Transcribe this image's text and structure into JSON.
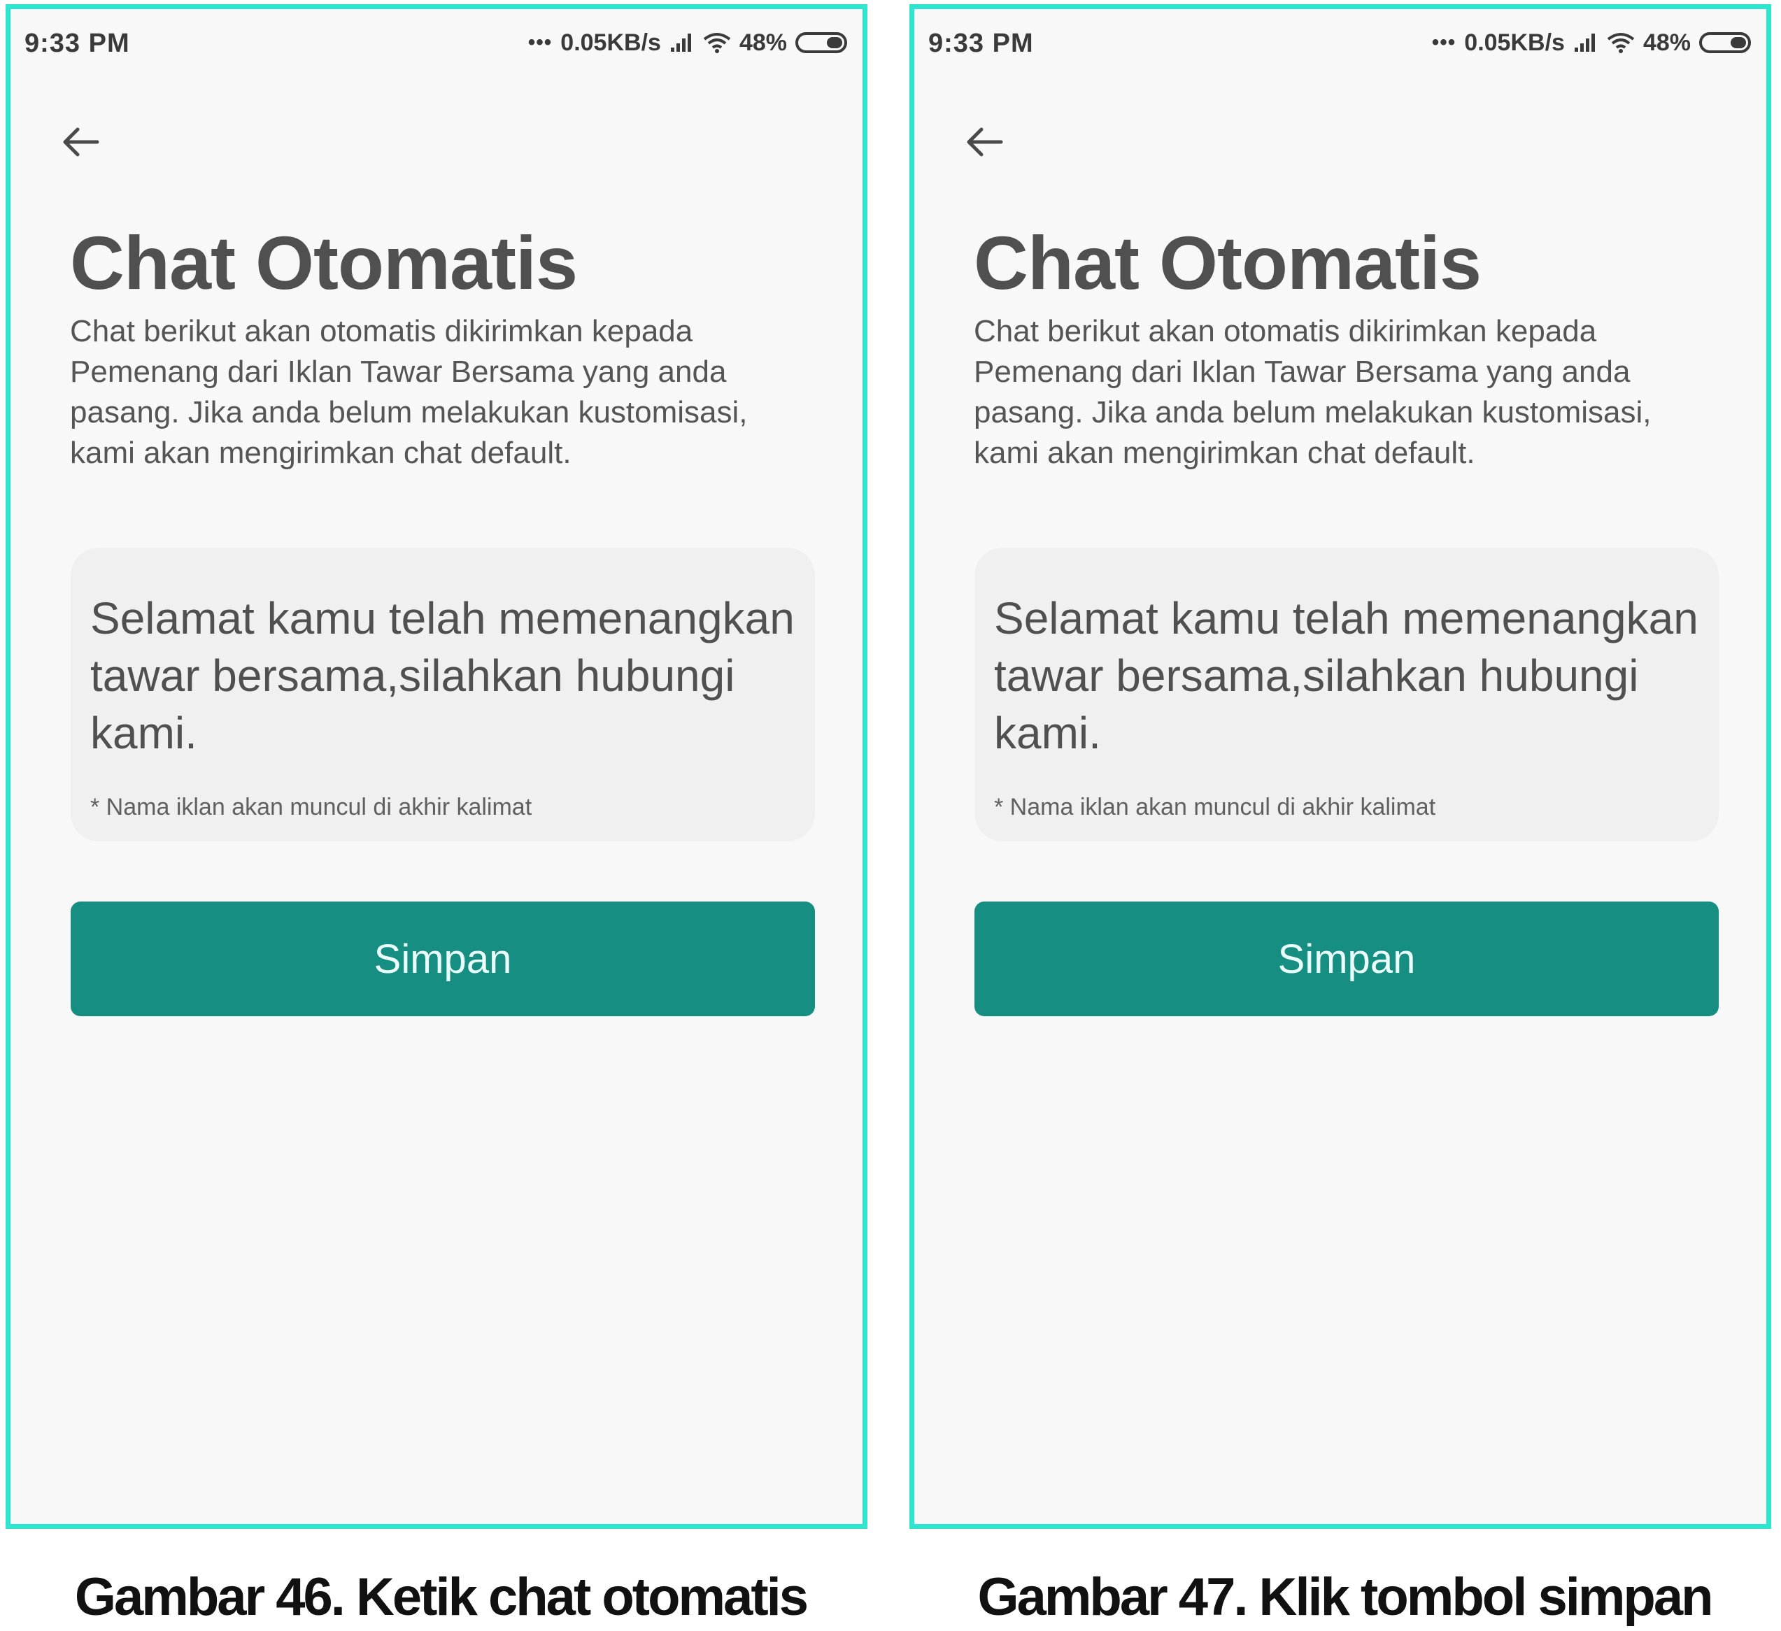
{
  "colors": {
    "frame_border": "#2ee6cf",
    "screen_background": "#f8f8f8",
    "card_background": "#f0f0f0",
    "button_background": "#168f82",
    "button_text": "#eafffb"
  },
  "screens": [
    {
      "status_bar": {
        "time": "9:33 PM",
        "indicator_dots": "•••",
        "network_speed": "0.05KB/s",
        "battery_percent": "48%",
        "icons": [
          "signal-icon",
          "wifi-icon",
          "battery-icon"
        ]
      },
      "back_icon": "back-arrow-icon",
      "title": "Chat Otomatis",
      "description": "Chat berikut akan otomatis dikirimkan kepada Pemenang dari Iklan Tawar Bersama yang anda pasang. Jika anda belum melakukan kustomisasi, kami akan mengirimkan chat default.",
      "message": "Selamat kamu telah memenangkan tawar bersama,silahkan hubungi kami.",
      "note": "* Nama iklan akan muncul di akhir kalimat",
      "save_label": "Simpan",
      "caption": "Gambar 46. Ketik chat otomatis"
    },
    {
      "status_bar": {
        "time": "9:33 PM",
        "indicator_dots": "•••",
        "network_speed": "0.05KB/s",
        "battery_percent": "48%",
        "icons": [
          "signal-icon",
          "wifi-icon",
          "battery-icon"
        ]
      },
      "back_icon": "back-arrow-icon",
      "title": "Chat Otomatis",
      "description": "Chat berikut akan otomatis dikirimkan kepada Pemenang dari Iklan Tawar Bersama yang anda pasang. Jika anda belum melakukan kustomisasi, kami akan mengirimkan chat default.",
      "message": "Selamat kamu telah memenangkan tawar bersama,silahkan hubungi kami.",
      "note": "* Nama iklan akan muncul di akhir kalimat",
      "save_label": "Simpan",
      "caption": "Gambar 47. Klik tombol simpan"
    }
  ]
}
